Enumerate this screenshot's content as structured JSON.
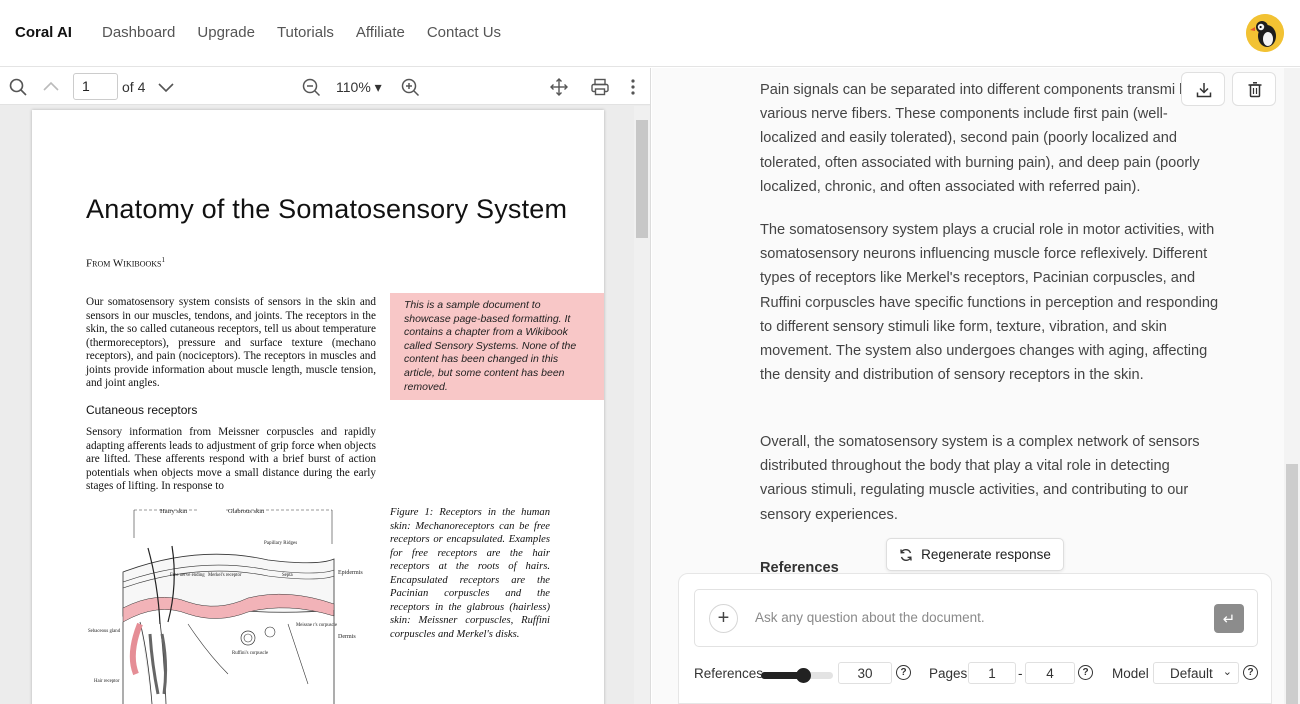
{
  "app": {
    "brand": "Coral AI",
    "nav": [
      "Dashboard",
      "Upgrade",
      "Tutorials",
      "Affiliate",
      "Contact Us"
    ]
  },
  "viewer": {
    "page_current": "1",
    "page_total_label": "of 4",
    "zoom": "110%",
    "doc": {
      "title": "Anatomy of the Somatosensory System",
      "from": "From Wikibooks",
      "from_sup": "1",
      "para1": "Our somatosensory system consists of sensors in the skin and sensors in our muscles, tendons, and joints. The receptors in the skin, the so called cutaneous receptors, tell us about temperature (thermoreceptors), pressure and surface texture (mechano receptors), and pain (nociceptors). The receptors in muscles and joints provide information about muscle length, muscle tension, and joint angles.",
      "h2": "Cutaneous receptors",
      "para2": "Sensory information from Meissner corpuscles and rapidly adapting afferents leads to adjustment of grip force when objects are lifted. These afferents respond with a brief burst of action potentials when objects move a small distance during the early stages of lifting. In response to",
      "note": "This is a sample document to showcase page-based formatting. It contains a chapter from a Wikibook called Sensory Systems. None of the content has been changed in this article, but some content has been removed.",
      "caption": "Figure 1: Receptors in the human skin: Mechanoreceptors can be free receptors or encapsulated. Examples for free receptors are the hair receptors at the roots of hairs. Encapsulated receptors are the Pacinian corpuscles and the receptors in the glabrous (hairless) skin: Meissner corpuscles, Ruffini corpuscles and Merkel's disks.",
      "figure_labels": {
        "hairy": "Hairy skin",
        "glabrous": "Glabrous skin",
        "papillary": "Papillary Ridges",
        "epidermis": "Epidermis",
        "dermis": "Dermis",
        "free_nerve": "Free nerve ending",
        "merkel": "Merkel's receptor",
        "septa": "Septa",
        "meissner": "Meissne r's corpuscle",
        "ruffini": "Ruffini's corpuscle",
        "sebaceous": "Sebaceous gland",
        "hair_receptor": "Hair receptor"
      }
    }
  },
  "chat": {
    "para1": "Pain signals can be separated into different components transmi by various nerve fibers. These components include first pain (well-localized and easily tolerated), second pain (poorly localized and tolerated, often associated with burning pain), and deep pain (poorly localized, chronic, and often associated with referred pain).",
    "para2": "The somatosensory system plays a crucial role in motor activities, with somatosensory neurons influencing muscle force reflexively. Different types of receptors like Merkel's receptors, Pacinian corpuscles, and Ruffini corpuscles have specific functions in perception and responding to different sensory stimuli like form, texture, vibration, and skin movement. The system also undergoes changes with aging, affecting the density and distribution of sensory receptors in the skin.",
    "para3": "Overall, the somatosensory system is a complex network of sensors distributed throughout the body that play a vital role in detecting various stimuli, regulating muscle activities, and contributing to our sensory experiences.",
    "references_heading": "References",
    "regenerate_label": "Regenerate response",
    "ask_placeholder": "Ask any question about the document.",
    "controls": {
      "references_label": "References",
      "references_value": "30",
      "references_fraction": 0.6,
      "pages_label": "Pages",
      "pages_from": "1",
      "pages_sep": "-",
      "pages_to": "4",
      "model_label": "Model",
      "model_value": "Default"
    }
  }
}
